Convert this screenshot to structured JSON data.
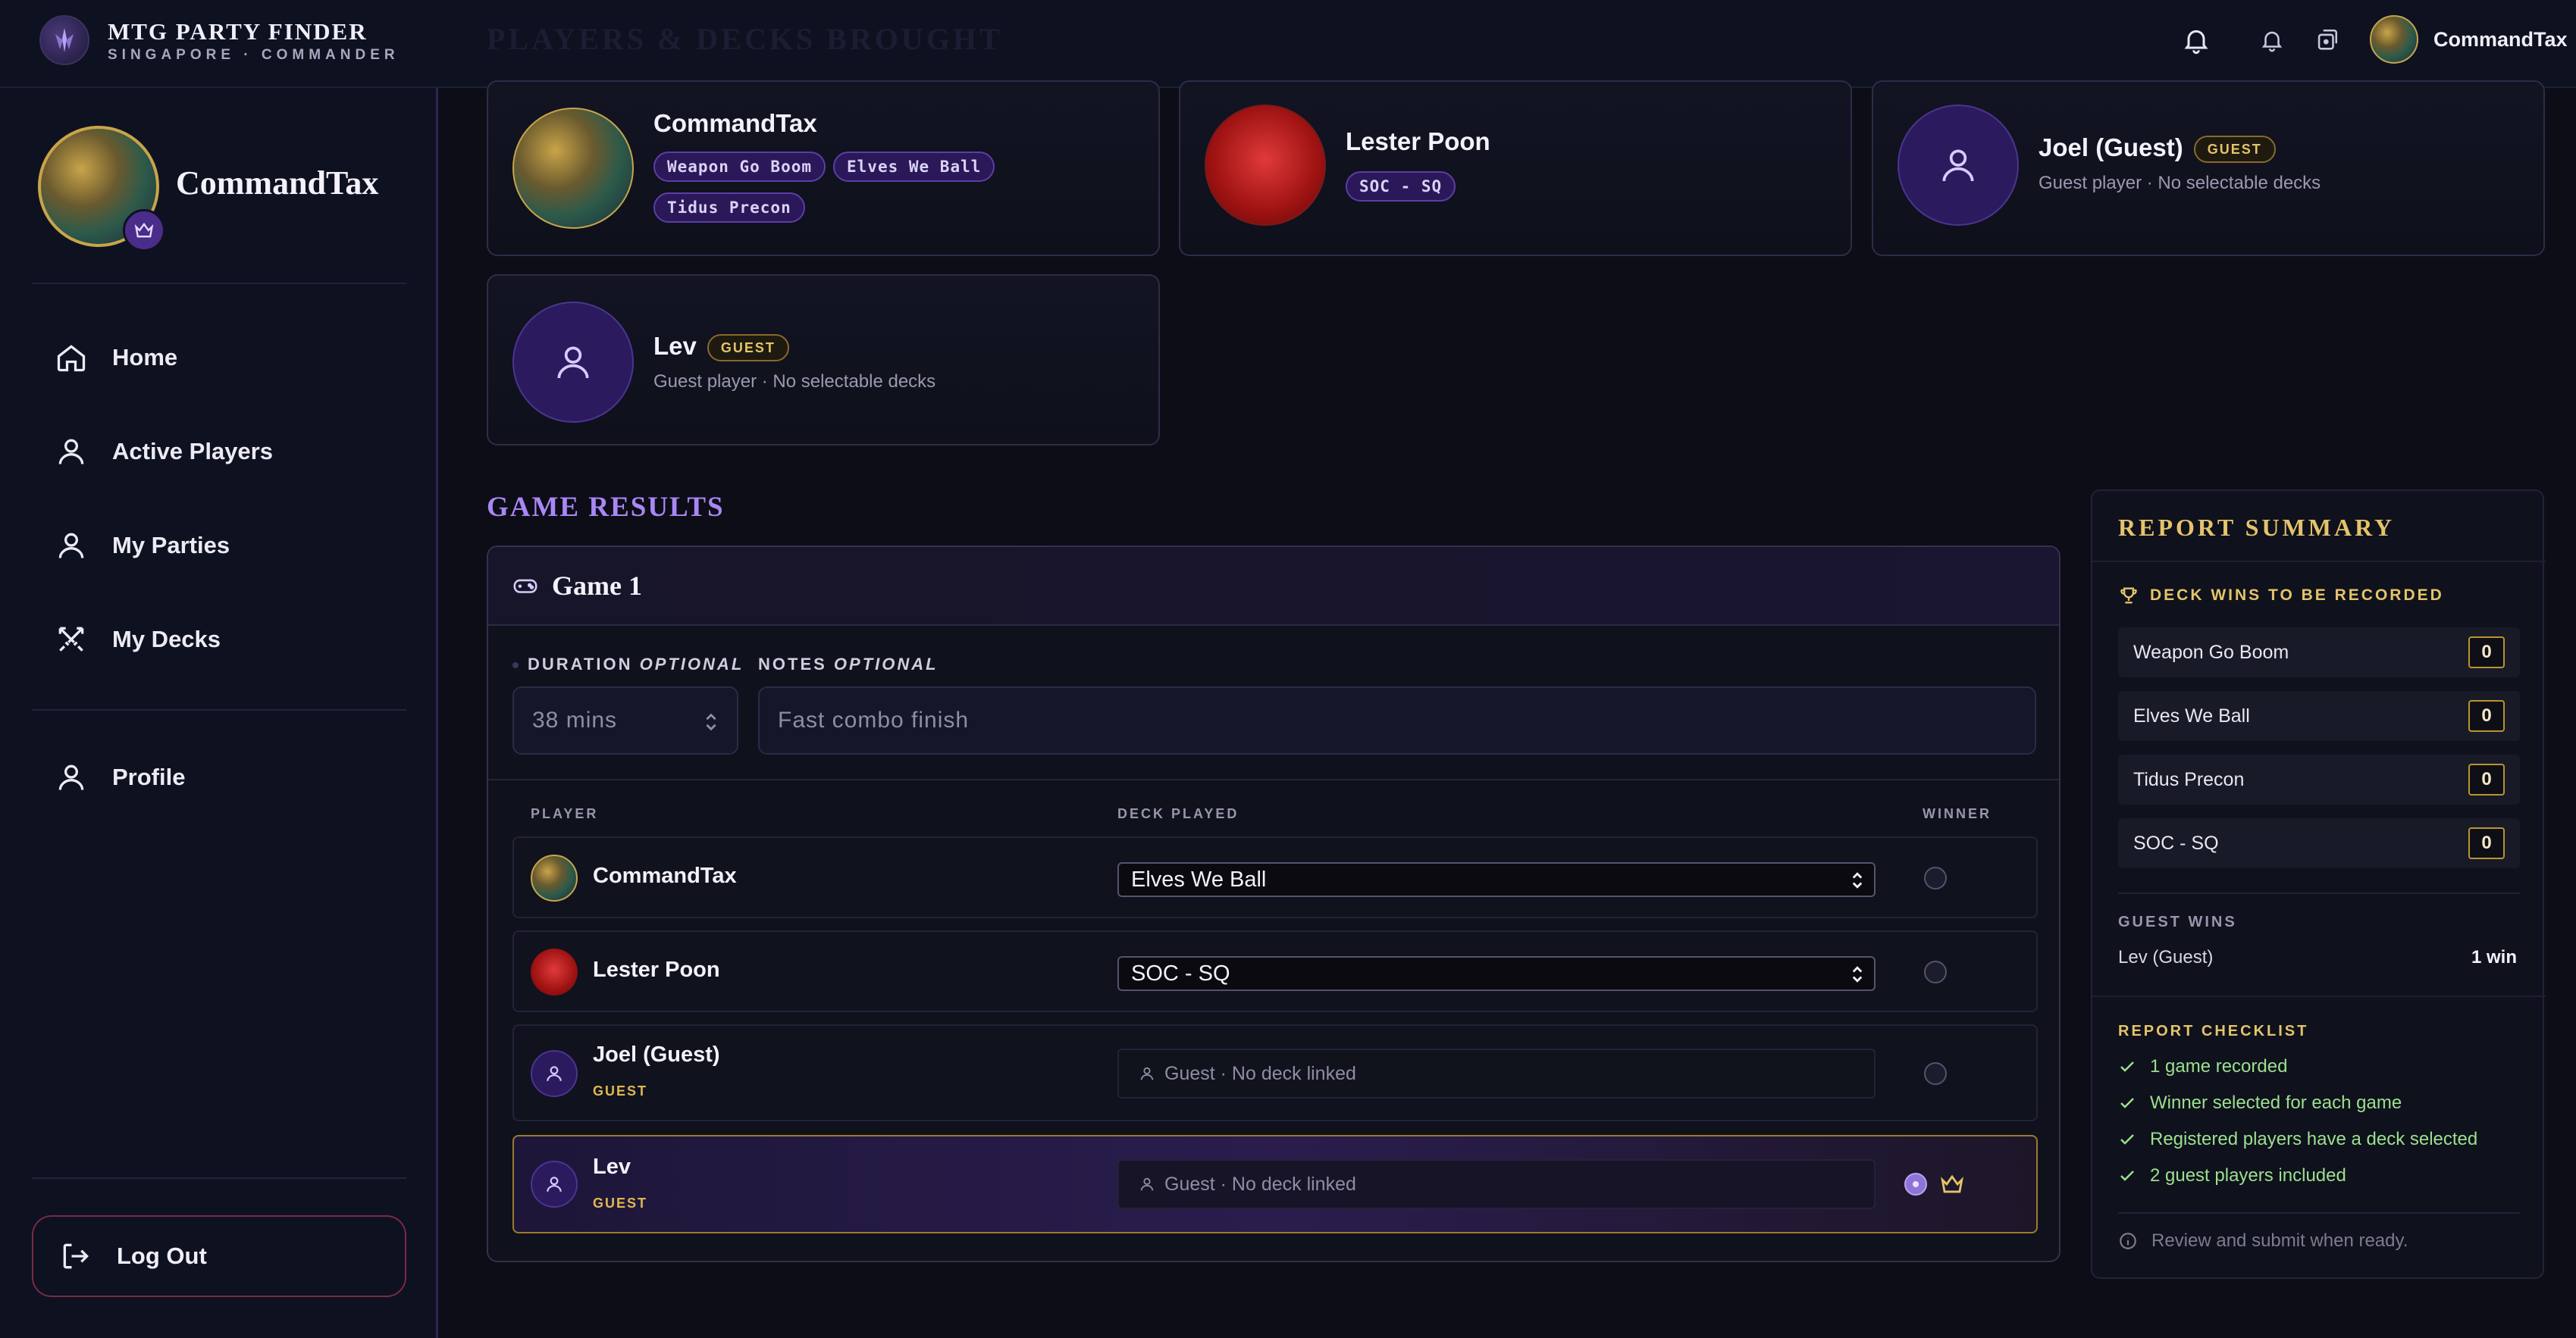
{
  "brand": {
    "title": "MTG PARTY FINDER",
    "subtitle": "SINGAPORE · COMMANDER"
  },
  "header": {
    "ghost_title": "PLAYERS & DECKS BROUGHT",
    "user_name": "CommandTax"
  },
  "sidebar": {
    "user_name": "CommandTax",
    "items": [
      {
        "label": "Home",
        "icon": "home-icon"
      },
      {
        "label": "Active Players",
        "icon": "user-icon"
      },
      {
        "label": "My Parties",
        "icon": "user-icon"
      },
      {
        "label": "My Decks",
        "icon": "swords-icon"
      },
      {
        "label": "Profile",
        "icon": "user-icon"
      }
    ],
    "logout_label": "Log Out"
  },
  "players": [
    {
      "name": "CommandTax",
      "decks": [
        "Weapon Go Boom",
        "Elves We Ball",
        "Tidus Precon"
      ]
    },
    {
      "name": "Lester Poon",
      "decks": [
        "SOC - SQ"
      ]
    },
    {
      "name": "Joel (Guest)",
      "badge": "GUEST",
      "sub": "Guest player · No selectable decks"
    },
    {
      "name": "Lev",
      "badge": "GUEST",
      "sub": "Guest player · No selectable decks"
    }
  ],
  "game_results": {
    "heading": "GAME RESULTS",
    "game_title": "Game 1",
    "duration_label": "DURATION",
    "notes_label": "NOTES",
    "optional_label": "OPTIONAL",
    "duration_placeholder": "38 mins",
    "notes_placeholder": "Fast combo finish",
    "col_player": "PLAYER",
    "col_deck": "DECK PLAYED",
    "col_winner": "WINNER",
    "rows": [
      {
        "name": "CommandTax",
        "deck": "Elves We Ball",
        "winner": false
      },
      {
        "name": "Lester Poon",
        "deck": "SOC - SQ",
        "winner": false
      },
      {
        "name": "Joel (Guest)",
        "badge": "GUEST",
        "deck_note": "Guest · No deck linked",
        "winner": false
      },
      {
        "name": "Lev",
        "badge": "GUEST",
        "deck_note": "Guest · No deck linked",
        "winner": true
      }
    ]
  },
  "summary": {
    "title": "REPORT SUMMARY",
    "deck_wins_label": "DECK WINS TO BE RECORDED",
    "deck_wins": [
      {
        "name": "Weapon Go Boom",
        "count": "0"
      },
      {
        "name": "Elves We Ball",
        "count": "0"
      },
      {
        "name": "Tidus Precon",
        "count": "0"
      },
      {
        "name": "SOC - SQ",
        "count": "0"
      }
    ],
    "guest_wins_label": "GUEST WINS",
    "guest_wins": [
      {
        "name": "Lev (Guest)",
        "value": "1 win"
      }
    ],
    "checklist_label": "REPORT CHECKLIST",
    "checklist": [
      "1 game recorded",
      "Winner selected for each game",
      "Registered players have a deck selected",
      "2 guest players included"
    ],
    "note": "Review and submit when ready."
  },
  "colors": {
    "accent": "#a987f5",
    "gold": "#e4c46a",
    "danger": "#7a2a45",
    "check": "#9be08f"
  }
}
